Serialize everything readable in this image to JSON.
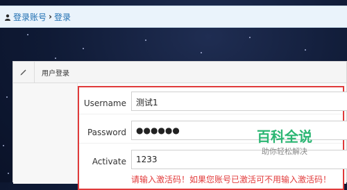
{
  "breadcrumb": {
    "items": [
      "登录账号",
      "登录"
    ],
    "separator": "›"
  },
  "panel": {
    "title": "用户登录"
  },
  "form": {
    "username": {
      "label": "Username",
      "value": "测试1"
    },
    "password": {
      "label": "Password",
      "value": "●●●●●●"
    },
    "activate": {
      "label": "Activate",
      "value": "1233"
    },
    "hint": "请输入激活码！如果您账号已激活可不用输入激活码！"
  },
  "watermark": {
    "title": "百科全说",
    "subtitle": "助你轻松解决"
  },
  "colors": {
    "breadcrumb_bg": "#eaf3fb",
    "link": "#1f6fb2",
    "error": "#e23b3b",
    "frame": "#e03a3a",
    "watermark": "#2bb673"
  }
}
